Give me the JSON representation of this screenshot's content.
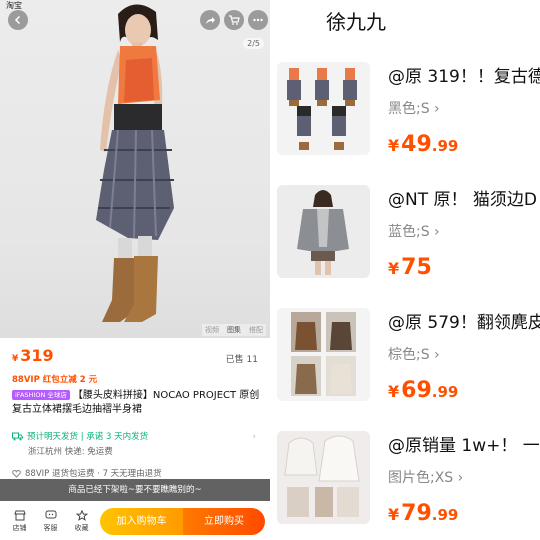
{
  "left": {
    "status_text": "淘宝",
    "page_counter": "2/5",
    "media_tabs": [
      "视频",
      "图集",
      "搭配"
    ],
    "price": {
      "currency": "¥",
      "value": "319"
    },
    "sold": "已售 11",
    "promo": "88VIP 红包立减 2 元",
    "title_tag": "iFASHION 全球店",
    "title": "【腰头皮料拼接】NOCAO PROJECT 原创复古立体裙摆毛边抽褶半身裙",
    "ship_line1": "预计明天发货 | 承诺 3 天内发货",
    "ship_line2": "浙江杭州  快递: 免运费",
    "returns": "88VIP 退货包运费 · 7 天无理由退货",
    "banner": "商品已经下架啦~要不要瞧瞧别的~",
    "bottom_bar": {
      "shop": "店铺",
      "service": "客服",
      "fav": "收藏"
    },
    "add_to_cart": "加入购物车",
    "buy_now": "立即购买"
  },
  "right": {
    "shop_name": "徐九九",
    "items": [
      {
        "title": "@原 319！！复古德",
        "spec": "黑色;S ›",
        "price_cur": "¥",
        "price_int": "49",
        "price_dec": ".99"
      },
      {
        "title": "@NT 原！  猫须边D",
        "spec": "蓝色;S ›",
        "price_cur": "¥",
        "price_int": "75",
        "price_dec": ""
      },
      {
        "title": "@原 579！翻领麂皮",
        "spec": "棕色;S ›",
        "price_cur": "¥",
        "price_int": "69",
        "price_dec": ".99"
      },
      {
        "title": "@原销量 1w+！  一",
        "spec": "图片色;XS ›",
        "price_cur": "¥",
        "price_int": "79",
        "price_dec": ".99"
      }
    ]
  },
  "colors": {
    "accent": "#ff5000",
    "green": "#0bb27b",
    "tag": "#b45cff"
  }
}
